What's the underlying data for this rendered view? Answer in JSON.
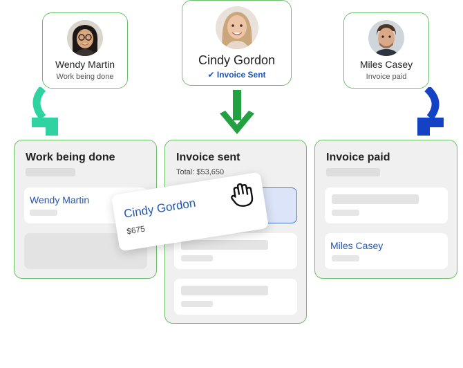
{
  "people": [
    {
      "name": "Wendy Martin",
      "status": "Work being done",
      "avatar_icon": "person-avatar-woman-glasses"
    },
    {
      "name": "Cindy Gordon",
      "status": "Invoice Sent",
      "status_icon": "checkmark-icon",
      "avatar_icon": "person-avatar-woman-blonde"
    },
    {
      "name": "Miles Casey",
      "status": "Invoice paid",
      "avatar_icon": "person-avatar-man"
    }
  ],
  "arrows": {
    "left": {
      "icon": "curved-arrow-down-icon",
      "color": "#2fd3a2"
    },
    "center": {
      "icon": "arrow-down-icon",
      "color": "#23a042"
    },
    "right": {
      "icon": "curved-arrow-down-icon",
      "color": "#1442c4"
    }
  },
  "columns": [
    {
      "title": "Work being done",
      "cards": [
        {
          "name": "Wendy Martin"
        }
      ]
    },
    {
      "title": "Invoice sent",
      "subtitle": "Total: $53,650"
    },
    {
      "title": "Invoice paid",
      "cards": [
        {
          "name": "Miles Casey"
        }
      ]
    }
  ],
  "dragged_card": {
    "name": "Cindy Gordon",
    "amount": "$675",
    "icon": "grab-hand-icon"
  },
  "colors": {
    "accent_green": "#6cc06a",
    "link_blue": "#1f56b5",
    "panel_gray": "#f0f0f0"
  }
}
